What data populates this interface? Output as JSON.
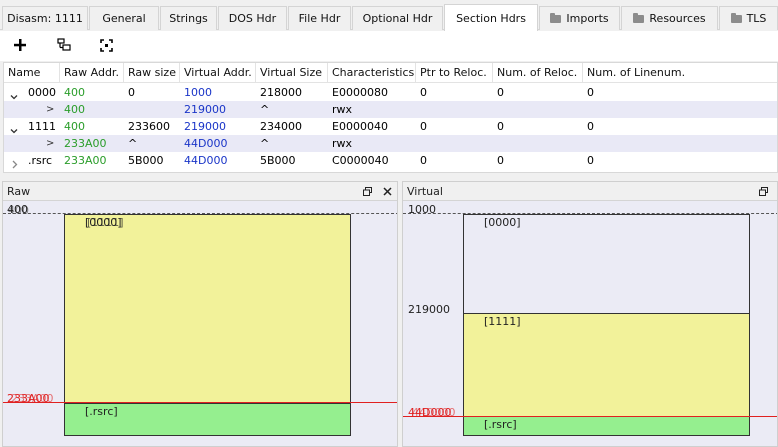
{
  "tabs": [
    {
      "label": "Disasm: 1111"
    },
    {
      "label": "General"
    },
    {
      "label": "Strings"
    },
    {
      "label": "DOS Hdr"
    },
    {
      "label": "File Hdr"
    },
    {
      "label": "Optional Hdr"
    },
    {
      "label": "Section Hdrs",
      "active": true
    },
    {
      "label": "Imports",
      "icon": "folder-icon"
    },
    {
      "label": "Resources",
      "icon": "folder-icon"
    },
    {
      "label": "TLS",
      "icon": "folder-icon"
    }
  ],
  "toolbar": {
    "add_icon": "plus-icon",
    "add_section_icon": "add-section-icon",
    "fit_icon": "fit-view-icon"
  },
  "table": {
    "columns": [
      "Name",
      "Raw Addr.",
      "Raw size",
      "Virtual Addr.",
      "Virtual Size",
      "Characteristics",
      "Ptr to Reloc.",
      "Num. of Reloc.",
      "Num. of Linenum."
    ],
    "rows": [
      {
        "expander": "v",
        "name": "0000",
        "raw_addr": "400",
        "raw_size": "0",
        "virt_addr": "1000",
        "virt_size": "218000",
        "characteristics": "E0000080",
        "ptr_reloc": "0",
        "num_reloc": "0",
        "num_linenum": "0"
      },
      {
        "expander": ">",
        "name": "",
        "raw_addr": "400",
        "raw_size": "",
        "virt_addr": "219000",
        "virt_size": "^",
        "characteristics": "rwx",
        "ptr_reloc": "",
        "num_reloc": "",
        "num_linenum": "",
        "sub": true
      },
      {
        "expander": "v",
        "name": "1111",
        "raw_addr": "400",
        "raw_size": "233600",
        "virt_addr": "219000",
        "virt_size": "234000",
        "characteristics": "E0000040",
        "ptr_reloc": "0",
        "num_reloc": "0",
        "num_linenum": "0"
      },
      {
        "expander": ">",
        "name": "",
        "raw_addr": "233A00",
        "raw_size": "^",
        "virt_addr": "44D000",
        "virt_size": "^",
        "characteristics": "rwx",
        "ptr_reloc": "",
        "num_reloc": "",
        "num_linenum": "",
        "sub": true
      },
      {
        "expander": ">",
        "name": ".rsrc",
        "raw_addr": "233A00",
        "raw_size": "5B000",
        "virt_addr": "44D000",
        "virt_size": "5B000",
        "characteristics": "C0000040",
        "ptr_reloc": "0",
        "num_reloc": "0",
        "num_linenum": "0"
      }
    ]
  },
  "raw_panel": {
    "title": "Raw",
    "restore_icon": "restore-icon",
    "close_icon": "close-icon",
    "top_addr": "400",
    "bottom_addr": "233A00",
    "bottom_addr_overlap": "233A00",
    "section_labels": [
      "[0000]",
      "[1111]",
      "[.rsrc]"
    ]
  },
  "virtual_panel": {
    "title": "Virtual",
    "restore_icon": "restore-icon",
    "top_addr": "1000",
    "mid_addr": "219000",
    "bottom_addr": "44D000",
    "bottom_addr_overlap": "44D000",
    "section_labels": [
      "[0000]",
      "[1111]",
      "[.rsrc]"
    ]
  },
  "colors": {
    "raw_addr_green": "#2a9d2a",
    "virt_addr_blue": "#1a35c8",
    "section_yellow": "#f2f29a",
    "section_green": "#95ef8f",
    "marker_red": "#e02020",
    "panel_bg": "#ebebf5"
  }
}
